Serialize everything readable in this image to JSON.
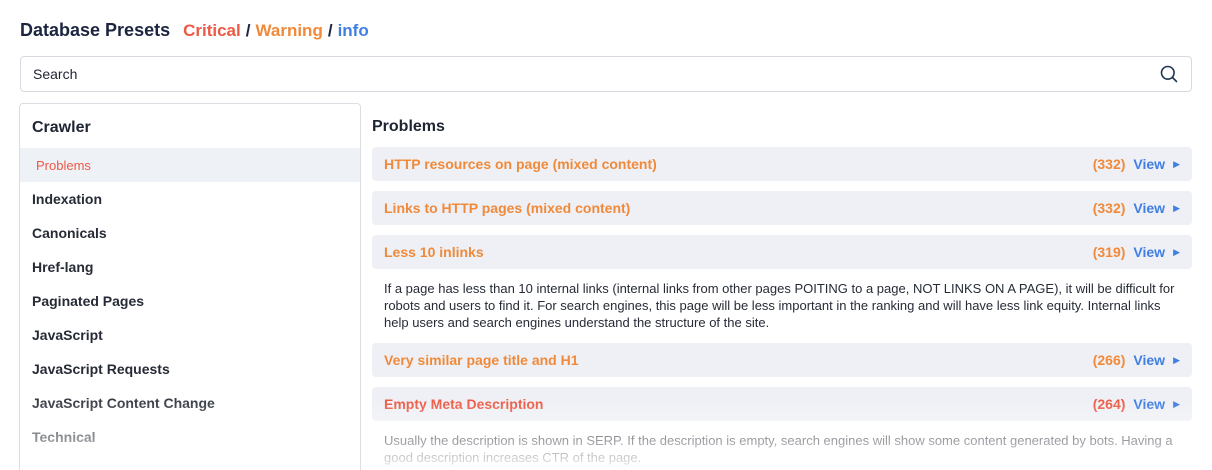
{
  "header": {
    "title": "Database Presets",
    "severity": {
      "critical": "Critical",
      "separator": "/",
      "warning": "Warning",
      "info": "info"
    }
  },
  "search": {
    "placeholder": "Search",
    "value": "",
    "icon": "search-icon"
  },
  "sidebar": {
    "title": "Crawler",
    "items": [
      {
        "label": "Problems",
        "active": true
      },
      {
        "label": "Indexation"
      },
      {
        "label": "Canonicals"
      },
      {
        "label": "Href-lang"
      },
      {
        "label": "Paginated Pages"
      },
      {
        "label": "JavaScript"
      },
      {
        "label": "JavaScript Requests"
      },
      {
        "label": "JavaScript Content Change"
      },
      {
        "label": "Technical"
      }
    ]
  },
  "main": {
    "title": "Problems",
    "problems": [
      {
        "label": "HTTP resources on page (mixed content)",
        "count": "(332)",
        "view": "View",
        "severity": "warning"
      },
      {
        "label": "Links to HTTP pages (mixed content)",
        "count": "(332)",
        "view": "View",
        "severity": "warning"
      },
      {
        "label": "Less 10 inlinks",
        "count": "(319)",
        "view": "View",
        "severity": "warning",
        "description": "If a page has less than 10 internal links (internal links from other pages POITING to a page, NOT LINKS ON A PAGE), it will be difficult for robots and users to find it. For search engines, this page will be less important in the ranking and will have less link equity. Internal links help users and search engines understand the structure of the site."
      },
      {
        "label": "Very similar page title and H1",
        "count": "(266)",
        "view": "View",
        "severity": "warning"
      },
      {
        "label": "Empty Meta Description",
        "count": "(264)",
        "view": "View",
        "severity": "critical",
        "description": "Usually the description is shown in SERP. If the description is empty, search engines will show some content generated by bots. Having a good description increases CTR of the page."
      }
    ]
  },
  "colors": {
    "critical": "#ec5a45",
    "warning": "#f08a3a",
    "info": "#3f7fe4",
    "row_bg": "#eef0f5",
    "title": "#1c2540"
  }
}
